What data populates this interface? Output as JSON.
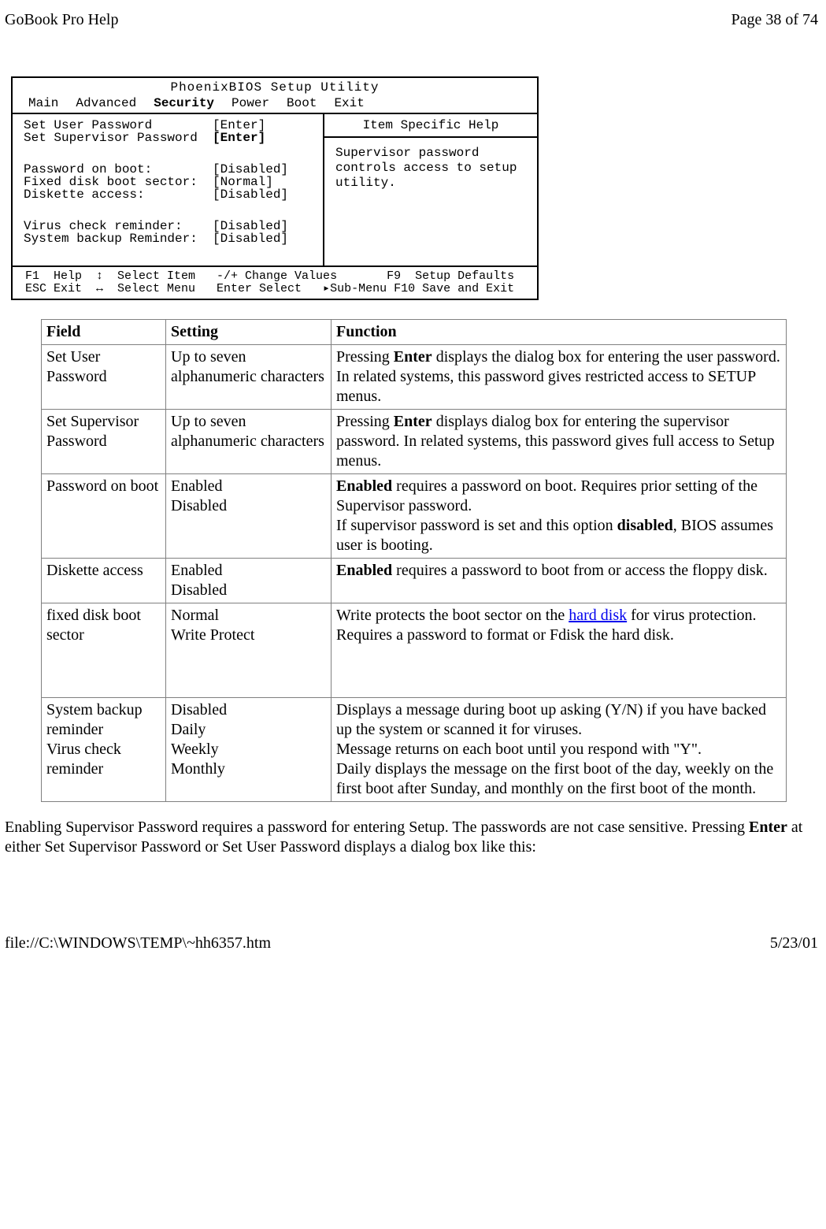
{
  "header": {
    "left": "GoBook Pro Help",
    "right": "Page 38 of 74"
  },
  "bios": {
    "title": "PhoenixBIOS Setup Utility",
    "menubar": [
      "Main",
      "Advanced",
      "Security",
      "Power",
      "Boot",
      "Exit"
    ],
    "left_rows1": [
      {
        "lab": "Set User Password",
        "val": "[Enter]"
      },
      {
        "lab": "Set Supervisor Password",
        "val": "[Enter]",
        "bold_val": true
      }
    ],
    "left_rows2": [
      {
        "lab": "Password on boot:",
        "val": "[Disabled]"
      },
      {
        "lab": "Fixed disk boot sector:",
        "val": "[Normal]"
      },
      {
        "lab": "Diskette access:",
        "val": "[Disabled]"
      }
    ],
    "left_rows3": [
      {
        "lab": "Virus check reminder:",
        "val": "[Disabled]"
      },
      {
        "lab": "System backup Reminder:",
        "val": "[Disabled]"
      }
    ],
    "right_title": "Item Specific Help",
    "right_body": "Supervisor password controls access to setup utility.",
    "footer_l1": "F1  Help  ↕  Select Item   -/+ Change Values       F9  Setup Defaults",
    "footer_l2": "ESC Exit  ↔  Select Menu   Enter Select   ▸Sub-Menu F10 Save and Exit"
  },
  "table": {
    "headers": {
      "field": "Field",
      "setting": "Setting",
      "function": "Function"
    },
    "rows": [
      {
        "field": "Set User Password",
        "setting": "Up to seven alphanumeric characters",
        "function_parts": [
          {
            "t": "Pressing "
          },
          {
            "t": "Enter",
            "b": true
          },
          {
            "t": " displays the dialog box for entering the user password.  In related systems, this password gives restricted access to SETUP menus."
          }
        ]
      },
      {
        "field": "Set Supervisor Password",
        "setting": "Up to seven alphanumeric characters",
        "function_parts": [
          {
            "t": "Pressing "
          },
          {
            "t": "Enter",
            "b": true
          },
          {
            "t": " displays dialog box for entering the supervisor password.  In related systems, this password gives full access to Setup menus."
          }
        ]
      },
      {
        "field": "Password on boot",
        "setting_lines": [
          "Enabled",
          "Disabled"
        ],
        "function_parts": [
          {
            "t": "Enabled",
            "b": true
          },
          {
            "t": " requires a password on boot.  Requires prior setting of the Supervisor password."
          },
          {
            "br": true
          },
          {
            "t": "If supervisor password is set and this option "
          },
          {
            "t": "disabled",
            "b": true
          },
          {
            "t": ", BIOS assumes user is booting."
          }
        ]
      },
      {
        "field": "Diskette access",
        "setting_lines": [
          "Enabled",
          "Disabled"
        ],
        "function_parts": [
          {
            "t": "Enabled",
            "b": true
          },
          {
            "t": " requires a password to boot from or access the floppy disk."
          }
        ]
      },
      {
        "field": "fixed disk boot sector",
        "setting_lines": [
          "Normal",
          "Write Protect"
        ],
        "function_parts": [
          {
            "t": "Write protects the boot sector on the "
          },
          {
            "t": "hard disk",
            "link": true
          },
          {
            "t": " for virus protection.  Requires a password to format or Fdisk the hard disk."
          }
        ]
      },
      {
        "field_lines": [
          "System backup reminder",
          "Virus check reminder"
        ],
        "setting_lines": [
          "Disabled",
          "Daily",
          "Weekly",
          "Monthly"
        ],
        "function_parts": [
          {
            "t": "Displays a message during boot up asking (Y/N) if you have backed up the system or scanned it for viruses."
          },
          {
            "br": true
          },
          {
            "t": "Message returns on each boot until you respond with \"Y\"."
          },
          {
            "br": true
          },
          {
            "t": "Daily displays the message on the first boot of the day, weekly on the first boot after Sunday, and monthly on the first boot of the month."
          }
        ]
      }
    ]
  },
  "bottom_para": {
    "parts": [
      {
        "t": "Enabling Supervisor Password requires a password for entering Setup.  The passwords are not case sensitive.  Pressing "
      },
      {
        "t": "Enter",
        "b": true
      },
      {
        "t": " at either Set Supervisor Password or Set User Password displays a dialog box like this:"
      }
    ]
  },
  "footer": {
    "left": "file://C:\\WINDOWS\\TEMP\\~hh6357.htm",
    "right": "5/23/01"
  }
}
